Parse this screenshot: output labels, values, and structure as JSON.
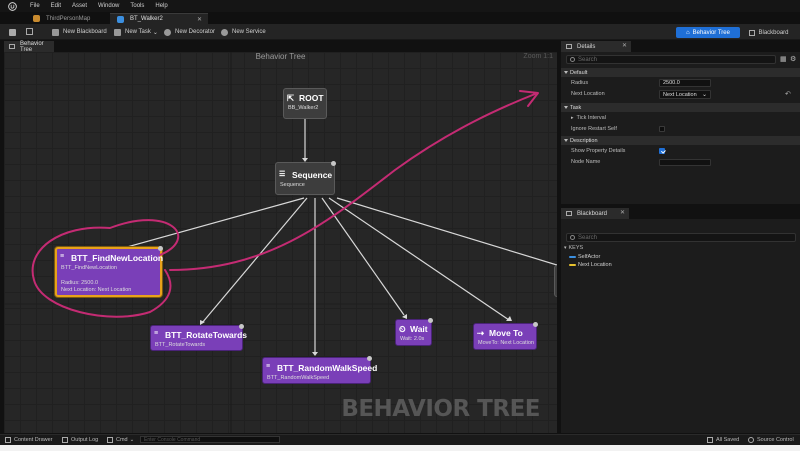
{
  "menu": [
    "File",
    "Edit",
    "Asset",
    "Window",
    "Tools",
    "Help"
  ],
  "tabs": [
    {
      "label": "ThirdPersonMap",
      "active": false
    },
    {
      "label": "BT_Walker2",
      "active": true
    }
  ],
  "toolbar": {
    "new_blackboard": "New Blackboard",
    "new_task": "New Task",
    "new_decorator": "New Decorator",
    "new_service": "New Service",
    "mode_behavior_tree": "Behavior Tree",
    "mode_blackboard": "Blackboard"
  },
  "graph": {
    "panel_tab": "Behavior Tree",
    "header": "Behavior Tree",
    "zoom": "Zoom 1:1",
    "watermark": "BEHAVIOR TREE"
  },
  "nodes": {
    "root": {
      "title": "ROOT",
      "subtitle": "BB_Walker2"
    },
    "sequence": {
      "title": "Sequence",
      "subtitle": "Sequence"
    },
    "find": {
      "title": "BTT_FindNewLocation",
      "subtitle": "BTT_FindNewLocation",
      "line1": "Radius: 2500.0",
      "line2": "Next Location: Next Location"
    },
    "rotate": {
      "title": "BTT_RotateTowards",
      "subtitle": "BTT_RotateTowards"
    },
    "speed": {
      "title": "BTT_RandomWalkSpeed",
      "subtitle": "BTT_RandomWalkSpeed"
    },
    "wait": {
      "title": "Wait",
      "subtitle": "Wait: 2.0s"
    },
    "moveto": {
      "title": "Move To",
      "subtitle": "MoveTo: Next Location"
    }
  },
  "details": {
    "tab": "Details",
    "search_placeholder": "Search",
    "sections": {
      "default": "Default",
      "task": "Task",
      "description": "Description"
    },
    "radius_label": "Radius",
    "radius_value": "2500.0",
    "next_location_label": "Next Location",
    "next_location_value": "Next Location",
    "tick_interval": "Tick Interval",
    "ignore_restart": "Ignore Restart Self",
    "show_property": "Show Property Details",
    "node_name": "Node Name",
    "show_property_checked": true,
    "ignore_restart_checked": false
  },
  "blackboard": {
    "tab": "Blackboard",
    "search_placeholder": "Search",
    "keys_header": "KEYS",
    "keys": [
      {
        "name": "SelfActor",
        "color": "#3b8fe0"
      },
      {
        "name": "Next Location",
        "color": "#e6c12e"
      }
    ]
  },
  "statusbar": {
    "content_drawer": "Content Drawer",
    "output_log": "Output Log",
    "cmd": "Cmd",
    "console_placeholder": "Enter Console Command",
    "all_saved": "All Saved",
    "source_control": "Source Control"
  },
  "colors": {
    "accent": "#1f6fd6",
    "task_node": "#7a3fb8",
    "selected_outline": "#e8a21a",
    "annotation": "#c42b73"
  }
}
